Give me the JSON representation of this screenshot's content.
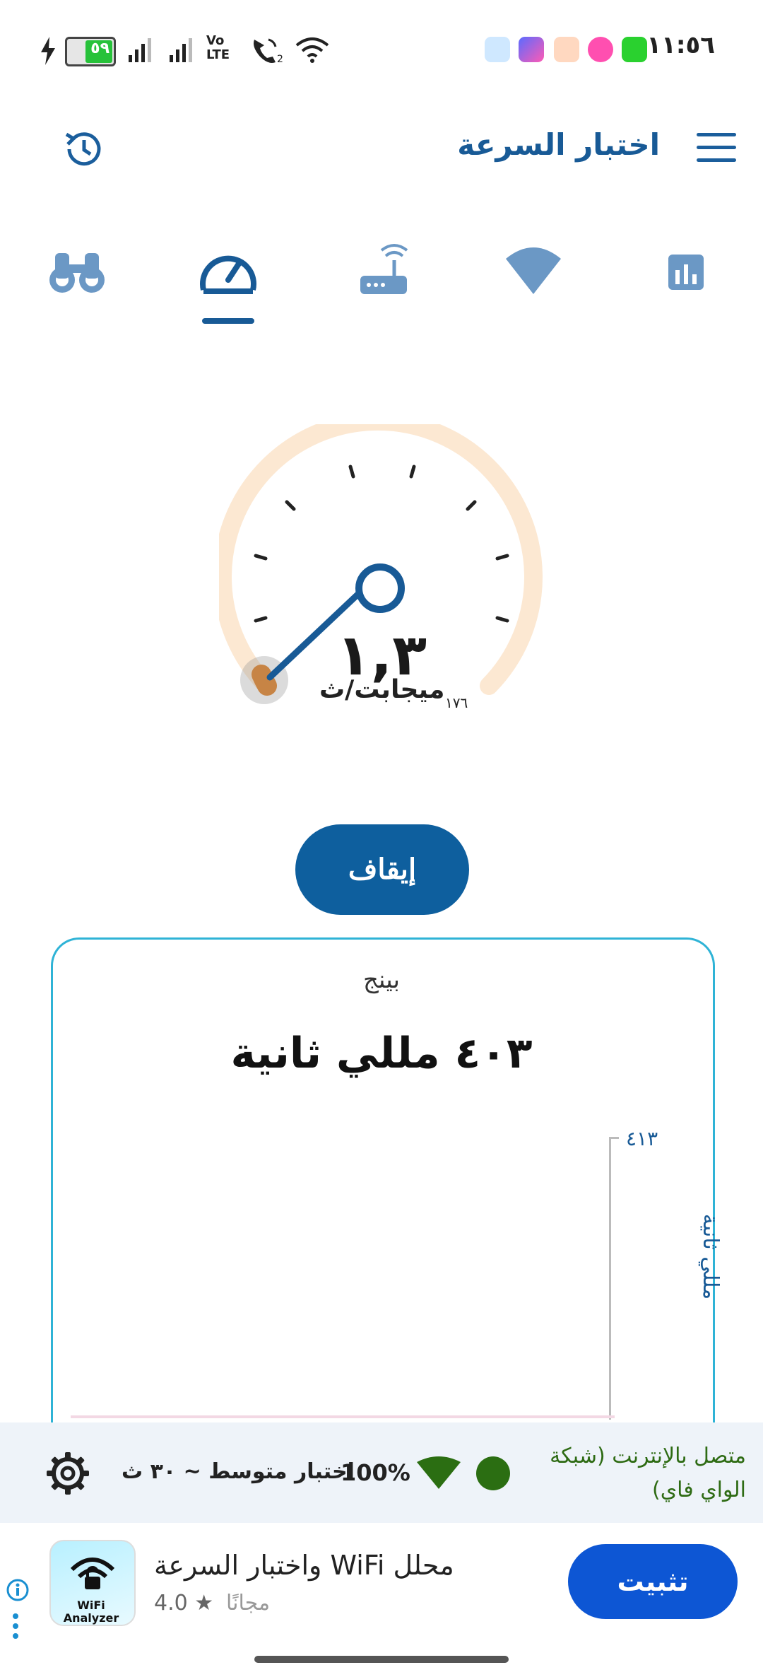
{
  "status_bar": {
    "time": "١١:٥٦",
    "battery_level": "٥٩",
    "network_label": "Vo LTE"
  },
  "header": {
    "title": "اختبار السرعة"
  },
  "tabs": [
    {
      "name": "binoculars-icon",
      "active": false
    },
    {
      "name": "speedometer-icon",
      "active": true
    },
    {
      "name": "router-icon",
      "active": false
    },
    {
      "name": "wifi-icon",
      "active": false
    },
    {
      "name": "chart-icon",
      "active": false
    }
  ],
  "gauge": {
    "speed": "١,٣",
    "unit": "ميجابت/ث",
    "small_label": "١٧٦",
    "track_color": "#fbe3c6",
    "progress_color": "#e07a1a",
    "needle_color": "#185a96"
  },
  "stop_button": {
    "label": "إيقاف"
  },
  "ping_card": {
    "label": "بينج",
    "value": "٤٠٣ مللي ثانية",
    "axis_max": "٤١٣",
    "axis_label": "مللي ثانية"
  },
  "network_status": {
    "text": "متصل بالإنترنت (شبكة الواي فاي)",
    "percent": "100%",
    "test_info": "اختبار متوسط ~ ٣٠ ث",
    "status_color": "#2b6e12"
  },
  "ad": {
    "app_name": "محلل WiFi واختبار السرعة",
    "rating": "4.0 ★",
    "price": "مجانًا",
    "install_label": "تثبيت",
    "icon_text": "WiFi Analyzer"
  }
}
